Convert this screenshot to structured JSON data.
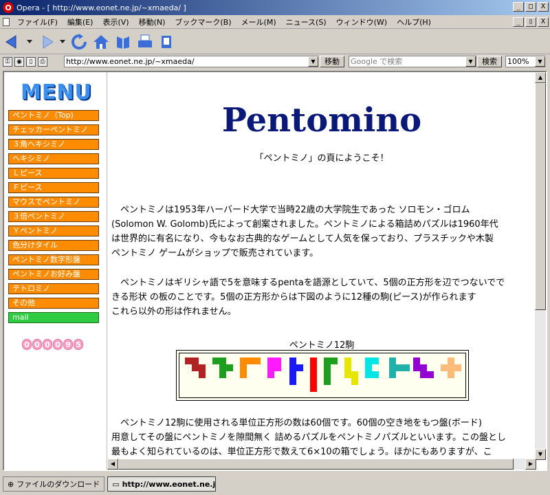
{
  "window": {
    "app_icon": "O",
    "title": "Opera - [ http://www.eonet.ne.jp/~xmaeda/ ]",
    "controls": [
      "_",
      "□",
      "X"
    ]
  },
  "menubar": {
    "items": [
      "ファイル(F)",
      "編集(E)",
      "表示(V)",
      "移動(N)",
      "ブックマーク(B)",
      "メール(M)",
      "ニュース(S)",
      "ウィンドウ(W)",
      "ヘルプ(H)"
    ],
    "mdi_controls": [
      "_",
      "▯",
      "X"
    ]
  },
  "toolbar": {
    "icons": [
      "back-icon",
      "back-dropdown-icon",
      "forward-icon",
      "forward-dropdown-icon",
      "reload-icon",
      "home-icon",
      "hotlist-icon",
      "print-icon",
      "print-preview-icon"
    ]
  },
  "addressbar": {
    "url": "http://www.eonet.ne.jp/~xmaeda/",
    "go_label": "移動",
    "search_placeholder": "Google で検索",
    "search_button": "検索",
    "zoom": "100%"
  },
  "sidebar": {
    "logo": "MENU",
    "items": [
      "ペントミノ（Top)",
      "チェッカーペントミノ",
      "３角ヘキシミノ",
      "ヘキシミノ",
      "Ｌピース",
      "Ｆピース",
      "マウスでペントミノ",
      "３倍ペントミノ",
      "Ｙペントミノ",
      "色分けタイル",
      "ペントミノ数字形盤",
      "ペントミノお好み盤",
      "テトロミノ",
      "その他"
    ],
    "mail": "mail",
    "counter": [
      "0",
      "0",
      "0",
      "0",
      "9",
      "5"
    ]
  },
  "content": {
    "title": "Pentomino",
    "welcome": "「ペントミノ」の頁にようこそ！",
    "para1": "　ペントミノは1953年ハーバード大学で当時22歳の大学院生であった ソロモン・ゴロム\n(Solomon W. Golomb)氏によって創案されました。ペントミノによる箱詰めパズルは1960年代\nは世界的に有名になり、今もなお古典的なゲームとして人気を保っており、プラスチックや木製\nペントミノ ゲームがショップで販売されています。",
    "para2": "　ペントミノはギリシャ語で5を意味するpentaを語源としていて、5個の正方形を辺でつないでで\nきる形状 の板のことです。5個の正方形からは下図のように12種の駒(ピース)が作られます\nこれら以外の形は作れません。",
    "figure_caption": "ペントミノ12駒",
    "pieces": [
      {
        "name": "W",
        "color": "#b22222"
      },
      {
        "name": "Y",
        "color": "#1e9e1e"
      },
      {
        "name": "V",
        "color": "#ff8c00"
      },
      {
        "name": "P",
        "color": "#ff1aff"
      },
      {
        "name": "Y2",
        "color": "#1a1aff"
      },
      {
        "name": "I",
        "color": "#ff0000"
      },
      {
        "name": "L",
        "color": "#1e9e1e"
      },
      {
        "name": "N",
        "color": "#e6e600"
      },
      {
        "name": "U",
        "color": "#00e6e6"
      },
      {
        "name": "T",
        "color": "#20b2aa"
      },
      {
        "name": "W2",
        "color": "#9400d3"
      },
      {
        "name": "X",
        "color": "#ffbb7a"
      }
    ],
    "para3": "　ペントミノ12駒に使用される単位正方形の数は60個です。60個の空き地をもつ盤(ボード)\n用意してその盤にペントミノを隙間無く 詰めるパズルをペントミノパズルといいます。この盤とし\n最もよく知られているのは、単位正方形で数えて6×10の箱でしょう。ほかにもありますが、こ"
  },
  "statusbar": {
    "downloads": "ファイルのダウンロード",
    "tab": "http://www.eonet.ne.jp/~xmaeda/"
  }
}
